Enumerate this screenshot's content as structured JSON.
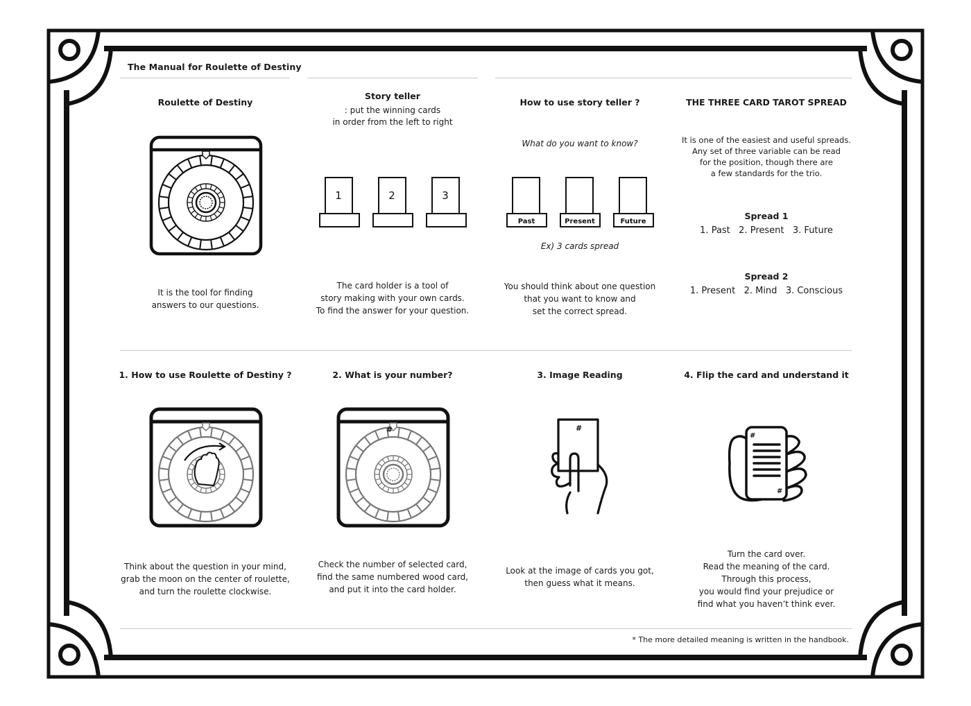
{
  "page_title": "The Manual for Roulette of Destiny",
  "top": {
    "roulette": {
      "heading": "Roulette of Destiny",
      "description": [
        "It is the tool for finding",
        "answers  to our questions."
      ]
    },
    "story_teller": {
      "heading": "Story teller",
      "subtitle": [
        ": put the winning cards",
        "in order from the left to right"
      ],
      "cards": [
        "1",
        "2",
        "3"
      ],
      "description": [
        "The card holder is a tool of",
        "story making with your own cards.",
        "To find the answer for your question."
      ]
    },
    "how_to_story": {
      "heading": "How to use story teller ?",
      "question": "What do you want to know?",
      "holder_labels": [
        "Past",
        "Present",
        "Future"
      ],
      "caption": "Ex) 3 cards spread",
      "description": [
        "You should think about one question",
        "that you want to know and",
        "set the correct spread."
      ]
    },
    "tarot": {
      "heading": "THE THREE CARD TAROT SPREAD",
      "intro": [
        "It is one of the easiest and useful spreads.",
        "Any set of three variable can be read",
        "for the position, though there are",
        "a few standards for the trio."
      ],
      "spreads": [
        {
          "title": "Spread 1",
          "items": "1. Past   2. Present   3. Future"
        },
        {
          "title": "Spread 2",
          "items": "1. Present   2. Mind   3. Conscious"
        }
      ]
    }
  },
  "steps": [
    {
      "heading": "1. How to use Roulette of Destiny ?",
      "description": [
        "Think about the question in your mind,",
        "grab the moon on the center of roulette,",
        "and turn the roulette clockwise."
      ]
    },
    {
      "heading": "2. What is your number?",
      "marker": "#",
      "description": [
        "Check the number of selected card,",
        "find the same numbered wood card,",
        "and put it into the card holder."
      ]
    },
    {
      "heading": "3. Image Reading",
      "marker": "#",
      "description": [
        "Look at the image of cards you got,",
        "then guess what it means."
      ]
    },
    {
      "heading": "4. Flip the card and understand it",
      "marker": "#",
      "description": [
        "Turn the card over.",
        "Read the meaning of the card.",
        "Through this process,",
        "you would find your prejudice or",
        "find what you haven’t think ever."
      ]
    }
  ],
  "footnote": "* The more detailed meaning is written in the handbook.",
  "colors": {
    "ink": "#111111",
    "gray_wheel": "#777777",
    "divider": "#c8c8c8"
  }
}
